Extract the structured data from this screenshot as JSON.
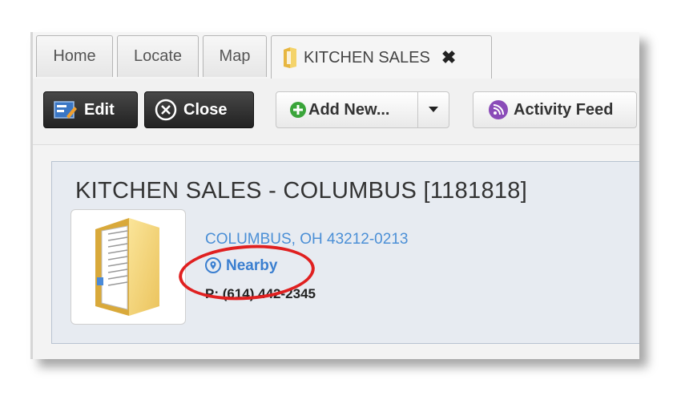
{
  "tabs": [
    {
      "label": "Home"
    },
    {
      "label": "Locate"
    },
    {
      "label": "Map"
    },
    {
      "label": "KITCHEN SALES",
      "active": true,
      "icon": "folder-icon"
    }
  ],
  "toolbar": {
    "edit_label": "Edit",
    "close_label": "Close",
    "add_new_label": "Add New...",
    "activity_feed_label": "Activity Feed"
  },
  "record": {
    "title": "KITCHEN SALES - COLUMBUS [1181818]",
    "address": "COLUMBUS, OH 43212-0213",
    "nearby_label": "Nearby",
    "phone": "P: (614) 442-2345"
  },
  "colors": {
    "link": "#4b8fd6",
    "annotation": "#e02020",
    "panel_bg": "#e7ebf1"
  }
}
